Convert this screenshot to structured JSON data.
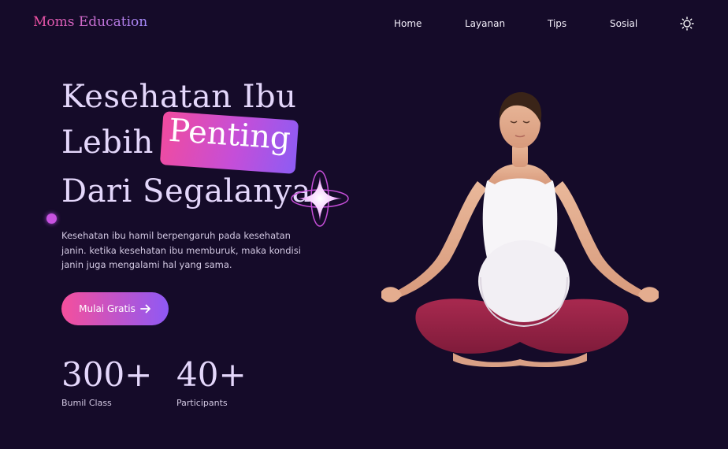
{
  "brand": "Moms Education",
  "nav": {
    "items": [
      "Home",
      "Layanan",
      "Tips",
      "Sosial"
    ],
    "theme_icon": "sun-icon"
  },
  "hero": {
    "line1": "Kesehatan Ibu",
    "line2": "Lebih",
    "highlight": "Penting",
    "line3": "Dari Segalanya",
    "description": "Kesehatan ibu hamil berpengaruh pada kesehatan janin. ketika kesehatan ibu memburuk, maka kondisi janin juga mengalami hal yang sama.",
    "cta_label": "Mulai Gratis",
    "cta_icon": "arrow-right-icon"
  },
  "stats": [
    {
      "value": "300+",
      "label": "Bumil Class"
    },
    {
      "value": "40+",
      "label": "Participants"
    }
  ],
  "colors": {
    "background": "#150b29",
    "accent_pink": "#f14b9e",
    "accent_purple": "#8e59f5",
    "heading": "#e4d7fb"
  }
}
